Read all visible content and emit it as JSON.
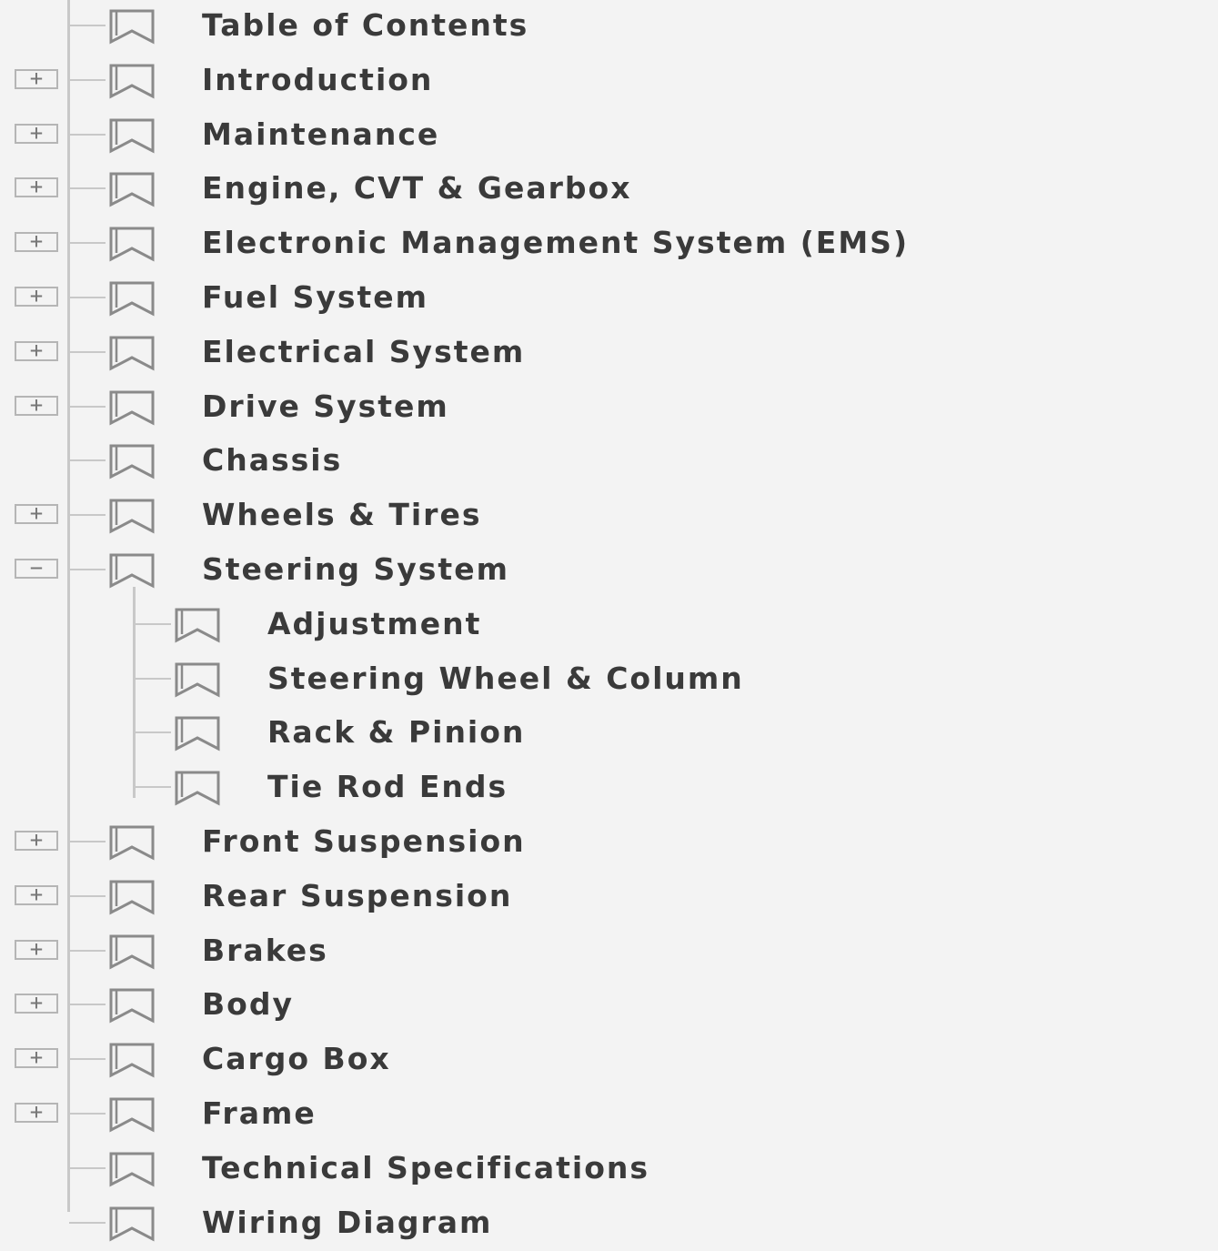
{
  "bookmarks_panel": {
    "items": [
      {
        "label": "Table of Contents",
        "expander": null
      },
      {
        "label": "Introduction",
        "expander": "+"
      },
      {
        "label": "Maintenance",
        "expander": "+"
      },
      {
        "label": "Engine, CVT & Gearbox",
        "expander": "+"
      },
      {
        "label": "Electronic Management System (EMS)",
        "expander": "+"
      },
      {
        "label": "Fuel System",
        "expander": "+"
      },
      {
        "label": "Electrical System",
        "expander": "+"
      },
      {
        "label": "Drive System",
        "expander": "+"
      },
      {
        "label": "Chassis",
        "expander": null
      },
      {
        "label": "Wheels & Tires",
        "expander": "+"
      },
      {
        "label": "Steering System",
        "expander": "−",
        "children": [
          {
            "label": "Adjustment"
          },
          {
            "label": "Steering Wheel & Column"
          },
          {
            "label": "Rack & Pinion"
          },
          {
            "label": "Tie Rod Ends"
          }
        ]
      },
      {
        "label": "Front Suspension",
        "expander": "+"
      },
      {
        "label": "Rear Suspension",
        "expander": "+"
      },
      {
        "label": "Brakes",
        "expander": "+"
      },
      {
        "label": "Body",
        "expander": "+"
      },
      {
        "label": "Cargo Box",
        "expander": "+"
      },
      {
        "label": "Frame",
        "expander": "+"
      },
      {
        "label": "Technical Specifications",
        "expander": null
      },
      {
        "label": "Wiring Diagram",
        "expander": null
      }
    ]
  }
}
